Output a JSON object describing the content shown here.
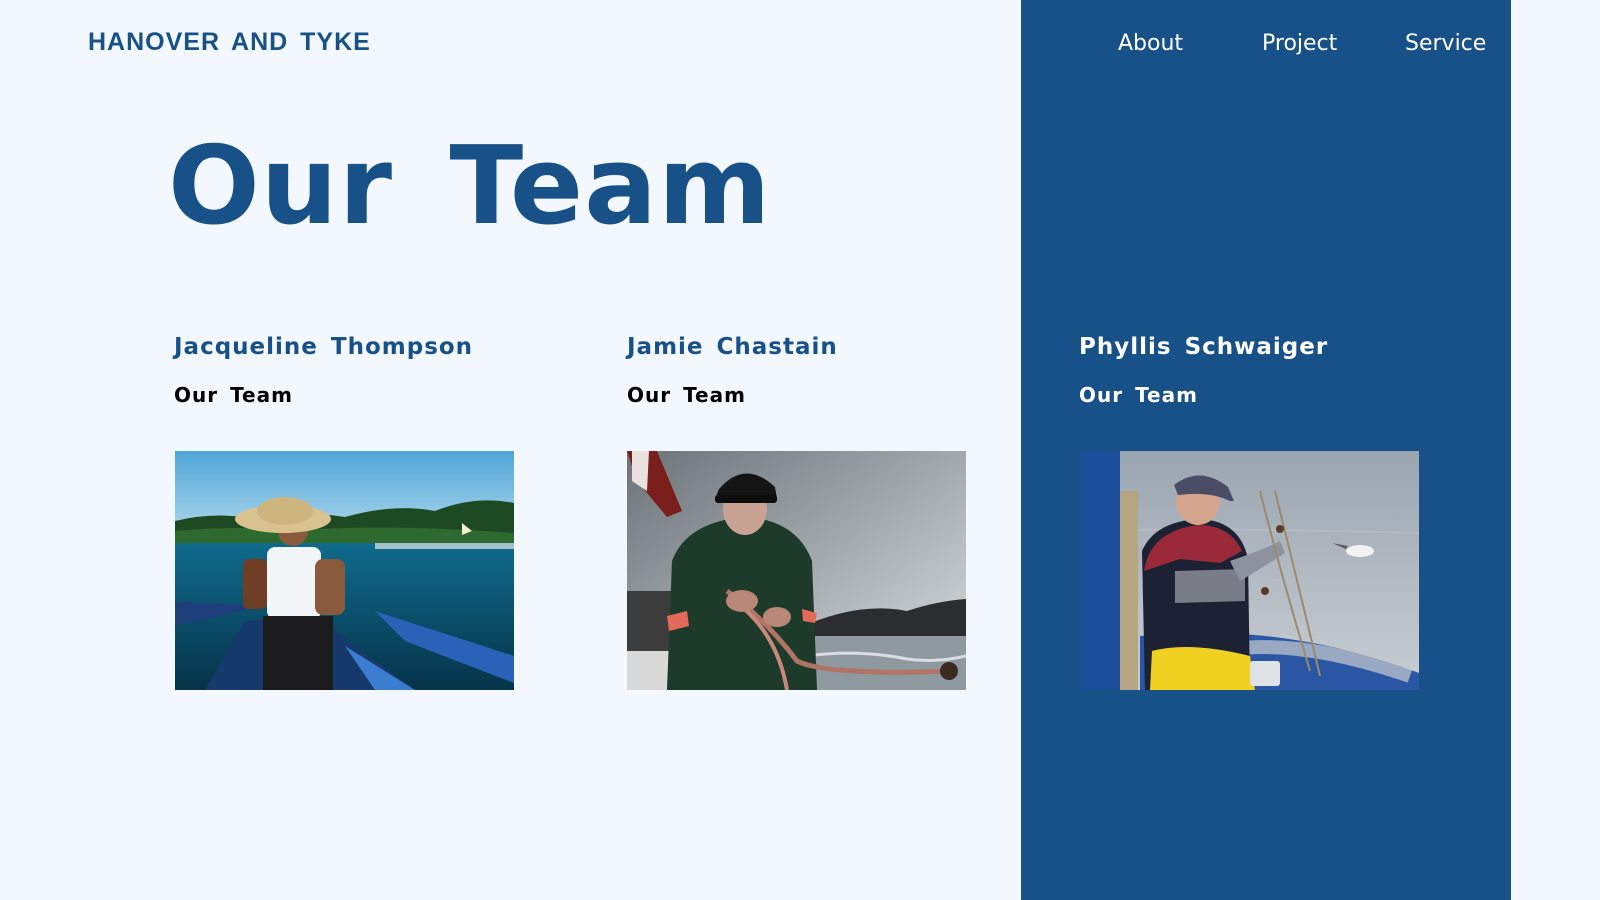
{
  "brand": {
    "name": "HANOVER AND TYKE"
  },
  "nav": {
    "items": [
      {
        "label": "About"
      },
      {
        "label": "Project"
      },
      {
        "label": "Service"
      }
    ]
  },
  "hero": {
    "title": "Our Team"
  },
  "team": {
    "members": [
      {
        "name": "Jacqueline Thompson",
        "role": "Our Team"
      },
      {
        "name": "Jamie Chastain",
        "role": "Our Team"
      },
      {
        "name": "Phyllis Schwaiger",
        "role": "Our Team"
      }
    ]
  },
  "colors": {
    "background": "#f3f8fe",
    "accent": "#185088",
    "text_dark": "#000000",
    "text_light": "#ffffff"
  }
}
